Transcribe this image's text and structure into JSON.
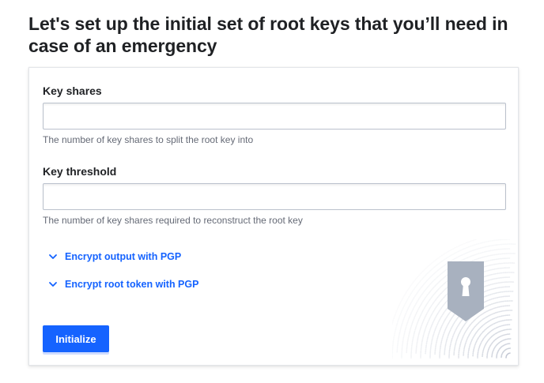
{
  "header": {
    "title": "Let's set up the initial set of root keys that you’ll need in case of an emergency"
  },
  "form": {
    "key_shares": {
      "label": "Key shares",
      "value": "",
      "help": "The number of key shares to split the root key into"
    },
    "key_threshold": {
      "label": "Key threshold",
      "value": "",
      "help": "The number of key shares required to reconstruct the root key"
    },
    "toggles": [
      {
        "label": "Encrypt output with PGP",
        "icon": "chevron-down-icon"
      },
      {
        "label": "Encrypt root token with PGP",
        "icon": "chevron-down-icon"
      }
    ],
    "submit_label": "Initialize"
  },
  "colors": {
    "accent": "#1563ff",
    "text": "#1f2124",
    "muted": "#656a76",
    "shield": "#a8b1bf"
  }
}
